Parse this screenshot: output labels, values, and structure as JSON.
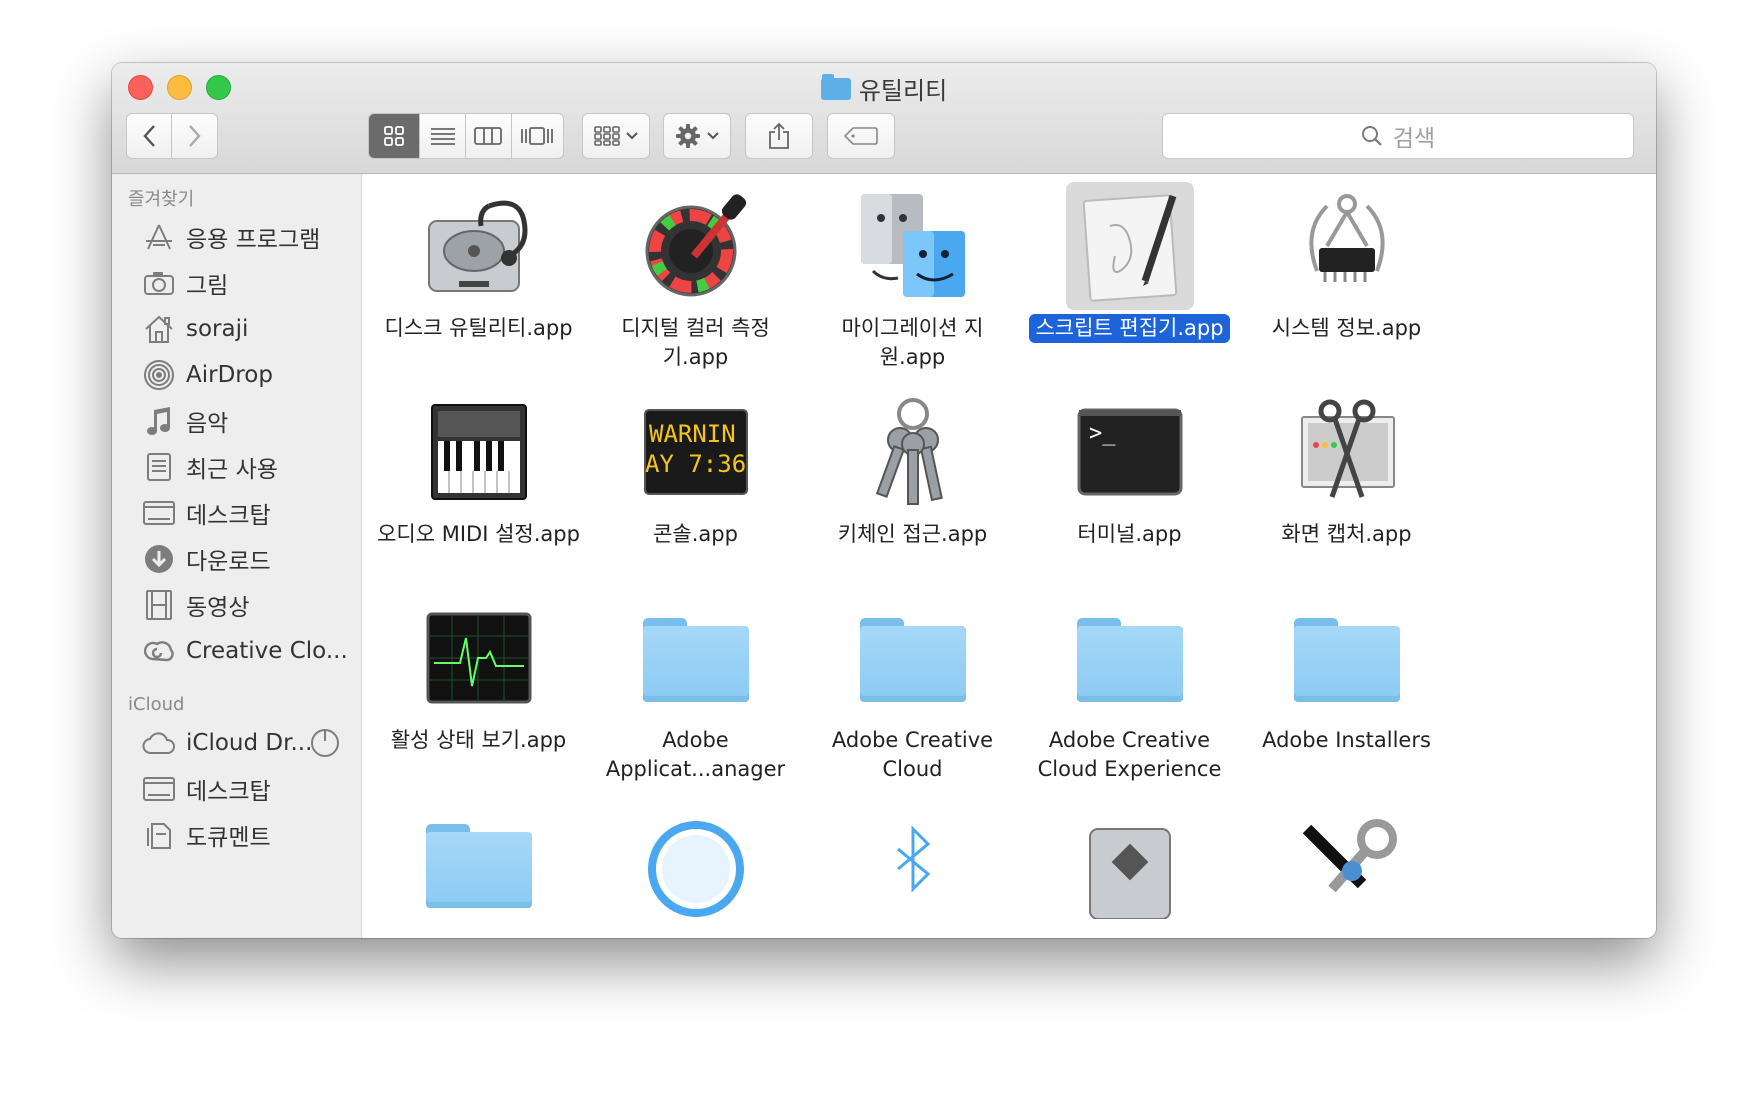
{
  "window": {
    "title": "유틸리티"
  },
  "search": {
    "placeholder": "검색"
  },
  "sidebar": {
    "favorites_header": "즐겨찾기",
    "favorites": [
      {
        "label": "응용 프로그램",
        "icon": "applications-icon"
      },
      {
        "label": "그림",
        "icon": "camera-icon"
      },
      {
        "label": "soraji",
        "icon": "home-icon"
      },
      {
        "label": "AirDrop",
        "icon": "airdrop-icon"
      },
      {
        "label": "음악",
        "icon": "music-icon"
      },
      {
        "label": "최근 사용",
        "icon": "recents-icon"
      },
      {
        "label": "데스크탑",
        "icon": "desktop-icon"
      },
      {
        "label": "다운로드",
        "icon": "download-icon"
      },
      {
        "label": "동영상",
        "icon": "film-icon"
      },
      {
        "label": "Creative Clo...",
        "icon": "creative-cloud-icon"
      }
    ],
    "icloud_header": "iCloud",
    "icloud": [
      {
        "label": "iCloud Dr...",
        "icon": "cloud-icon"
      },
      {
        "label": "데스크탑",
        "icon": "desktop-icon"
      },
      {
        "label": "도큐멘트",
        "icon": "document-icon"
      }
    ]
  },
  "files": [
    {
      "label": "디스크 유틸리티.app",
      "icon": "disk-utility-icon"
    },
    {
      "label": "디지털 컬러 측정기.app",
      "icon": "color-meter-icon"
    },
    {
      "label": "마이그레이션 지원.app",
      "icon": "migration-icon"
    },
    {
      "label": "스크립트 편집기.app",
      "icon": "script-editor-icon",
      "selected": true
    },
    {
      "label": "시스템 정보.app",
      "icon": "system-info-icon"
    },
    {
      "label": "오디오 MIDI 설정.app",
      "icon": "midi-icon"
    },
    {
      "label": "콘솔.app",
      "icon": "console-icon",
      "icon_text": [
        "WARNIN",
        "AY 7:36"
      ]
    },
    {
      "label": "키체인 접근.app",
      "icon": "keychain-icon"
    },
    {
      "label": "터미널.app",
      "icon": "terminal-icon",
      "icon_text": [
        ">_"
      ]
    },
    {
      "label": "화면 캡처.app",
      "icon": "screenshot-icon"
    },
    {
      "label": "활성 상태 보기.app",
      "icon": "activity-monitor-icon"
    },
    {
      "label": "Adobe Applicat...anager",
      "icon": "folder-icon"
    },
    {
      "label": "Adobe Creative Cloud",
      "icon": "folder-icon"
    },
    {
      "label": "Adobe Creative Cloud Experience",
      "icon": "folder-icon"
    },
    {
      "label": "Adobe Installers",
      "icon": "folder-icon"
    }
  ],
  "files_row4_icons": [
    "folder-icon",
    "bluetooth-circle-icon",
    "bluetooth-icon",
    "bootcamp-icon",
    "tools-icon"
  ]
}
